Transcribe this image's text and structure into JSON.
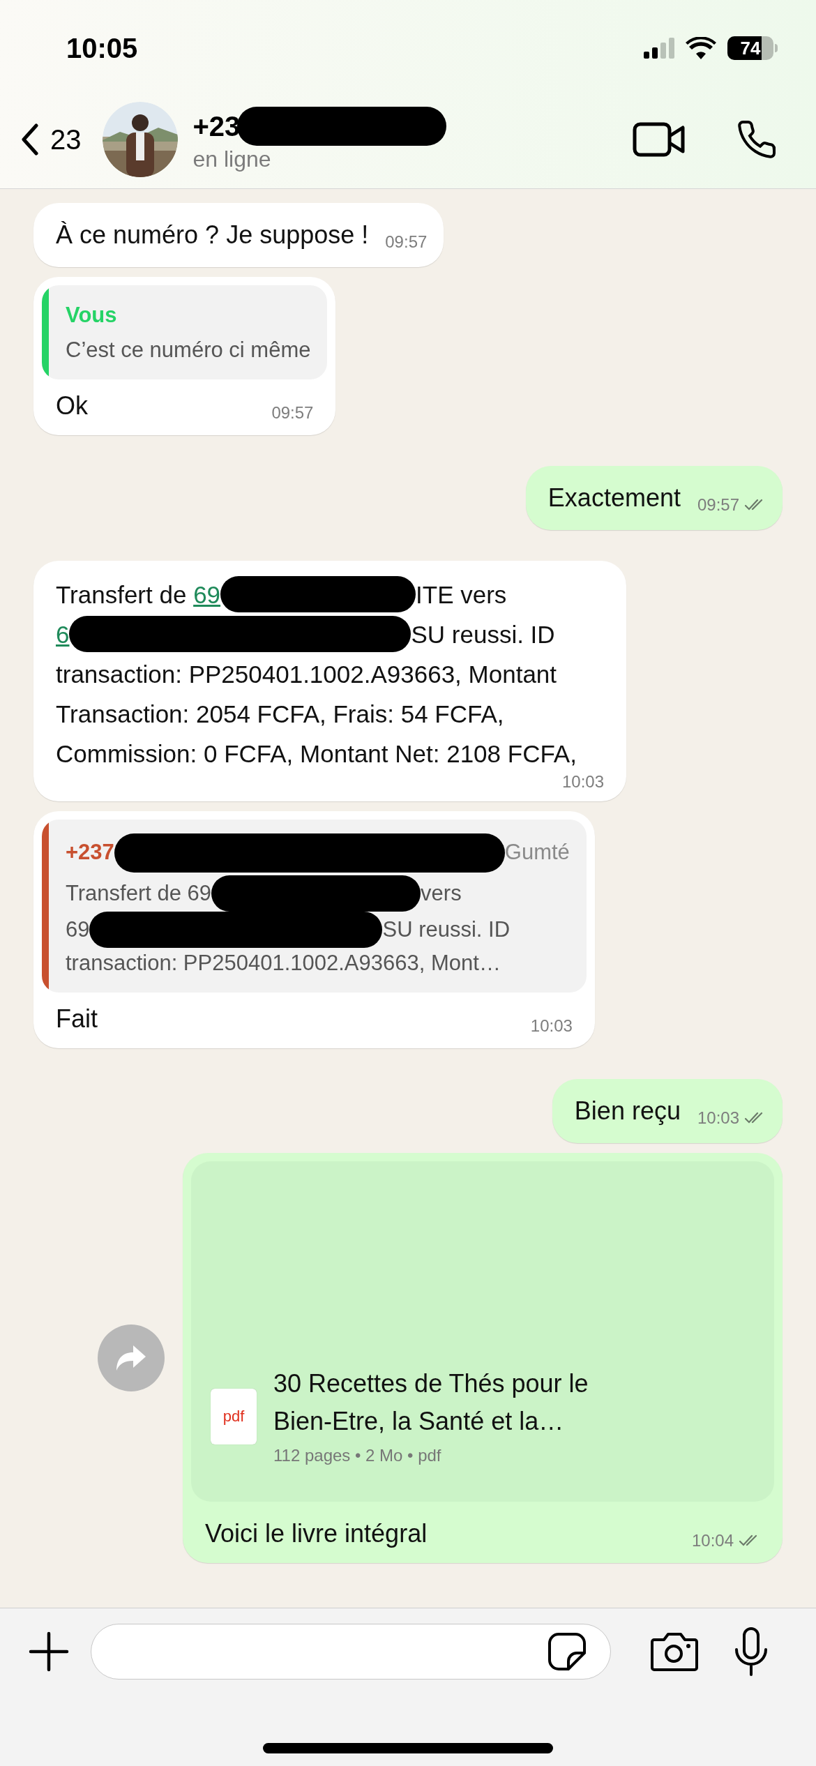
{
  "status_bar": {
    "time": "10:05",
    "battery": "74"
  },
  "header": {
    "back_count": "23",
    "contact_name": "+23",
    "contact_redacted": true,
    "presence": "en ligne"
  },
  "messages": [
    {
      "outgoing": false,
      "kind": "text",
      "text": "À ce numéro ? Je suppose !",
      "time": "09:57"
    },
    {
      "outgoing": false,
      "kind": "reply",
      "quote": {
        "author": "Vous",
        "color": "#25d366",
        "lines": [
          [
            {
              "kind": "text",
              "text": "C’est ce numéro ci même"
            }
          ]
        ]
      },
      "text": "Ok",
      "time": "09:57"
    },
    {
      "outgoing": true,
      "kind": "text",
      "text": "Exactement",
      "time": "09:57",
      "delivered": true
    },
    {
      "outgoing": false,
      "kind": "redacted",
      "lines": [
        [
          {
            "kind": "text",
            "text": "Transfert de "
          },
          {
            "kind": "link",
            "text": "69"
          },
          {
            "kind": "redacted"
          },
          {
            "kind": "text",
            "text": "ITE vers"
          }
        ],
        [
          {
            "kind": "link",
            "text": "6"
          },
          {
            "kind": "redacted"
          },
          {
            "kind": "text",
            "text": "SU reussi. ID"
          }
        ]
      ],
      "text": "transaction: PP250401.1002.A93663, Montant Transaction: 2054 FCFA, Frais: 54 FCFA, Commission: 0 FCFA, Montant Net: 2108 FCFA,",
      "time": "10:03"
    },
    {
      "outgoing": false,
      "kind": "reply",
      "quote": {
        "author": "+237",
        "author_end": "Gumté",
        "color": "#c8502f",
        "lines": [
          [
            {
              "kind": "text",
              "text": "Transfert de 69"
            },
            {
              "kind": "redacted"
            },
            {
              "kind": "text",
              "text": "vers"
            }
          ],
          [
            {
              "kind": "text",
              "text": "69"
            },
            {
              "kind": "redacted"
            },
            {
              "kind": "text",
              "text": "SU reussi. ID"
            }
          ],
          [
            {
              "kind": "text",
              "text": "transaction: PP250401.1002.A93663, Mont…"
            }
          ]
        ]
      },
      "text": "Fait",
      "time": "10:03"
    },
    {
      "outgoing": true,
      "kind": "text",
      "text": "Bien reçu",
      "time": "10:03",
      "delivered": true
    },
    {
      "outgoing": true,
      "kind": "document",
      "forward": true,
      "document": {
        "title": "30 Recettes de Thés pour le Bien-Etre, la Santé et la…",
        "file_type": "pdf",
        "meta": "112 pages • 2 Mo • pdf"
      },
      "text": "Voici le livre intégral",
      "time": "10:04",
      "delivered": true
    }
  ]
}
